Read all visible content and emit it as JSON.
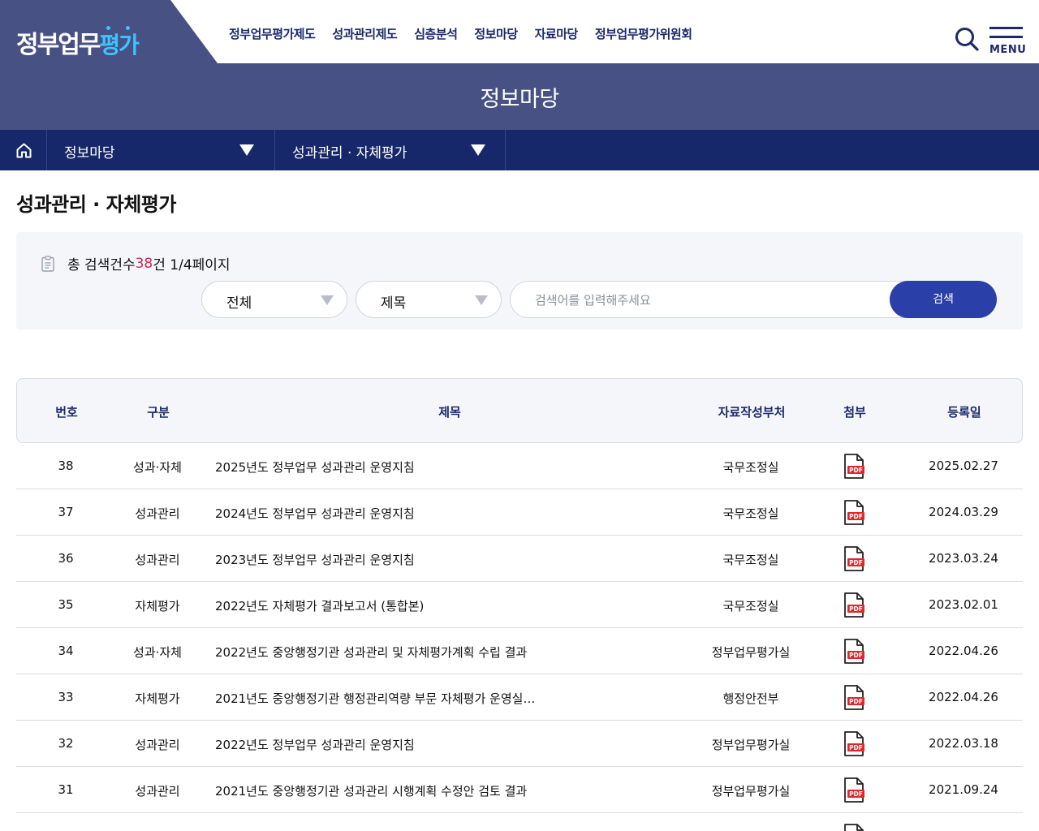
{
  "logo": {
    "text_main": "정부업무",
    "text_accent": "평가"
  },
  "gnb": [
    "정부업무평가제도",
    "성과관리제도",
    "심층분석",
    "정보마당",
    "자료마당",
    "정부업무평가위원회"
  ],
  "header_menu_label": "MENU",
  "visual_title": "정보마당",
  "location": {
    "depth1": "정보마당",
    "depth2": "성과관리 · 자체평가"
  },
  "page_title": "성과관리 · 자체평가",
  "search": {
    "count_prefix": "총 검색건수 ",
    "count_value": "38",
    "count_suffix": "건 1/4페이지",
    "category_select": "전체",
    "field_select": "제목",
    "placeholder": "검색어를 입력해주세요",
    "button_label": "검색"
  },
  "table": {
    "headers": [
      "번호",
      "구분",
      "제목",
      "자료작성부처",
      "첨부",
      "등록일"
    ],
    "rows": [
      {
        "num": "38",
        "category": "성과·자체",
        "title": "2025년도 정부업무 성과관리 운영지침",
        "dept": "국무조정실",
        "attachment": "PDF",
        "date": "2025.02.27"
      },
      {
        "num": "37",
        "category": "성과관리",
        "title": "2024년도 정부업무 성과관리 운영지침",
        "dept": "국무조정실",
        "attachment": "PDF",
        "date": "2024.03.29"
      },
      {
        "num": "36",
        "category": "성과관리",
        "title": "2023년도 정부업무 성과관리 운영지침",
        "dept": "국무조정실",
        "attachment": "PDF",
        "date": "2023.03.24"
      },
      {
        "num": "35",
        "category": "자체평가",
        "title": "2022년도 자체평가 결과보고서 (통합본)",
        "dept": "국무조정실",
        "attachment": "PDF",
        "date": "2023.02.01"
      },
      {
        "num": "34",
        "category": "성과·자체",
        "title": "2022년도 중앙행정기관 성과관리 및 자체평가계획 수립 결과",
        "dept": "정부업무평가실",
        "attachment": "PDF",
        "date": "2022.04.26"
      },
      {
        "num": "33",
        "category": "자체평가",
        "title": "2021년도 중앙행정기관 행정관리역량 부문 자체평가 운영실…",
        "dept": "행정안전부",
        "attachment": "PDF",
        "date": "2022.04.26"
      },
      {
        "num": "32",
        "category": "성과관리",
        "title": "2022년도 정부업무 성과관리 운영지침",
        "dept": "정부업무평가실",
        "attachment": "PDF",
        "date": "2022.03.18"
      },
      {
        "num": "31",
        "category": "성과관리",
        "title": "2021년도 중앙행정기관 성과관리 시행계획 수정안 검토 결과",
        "dept": "정부업무평가실",
        "attachment": "PDF",
        "date": "2021.09.24"
      },
      {
        "num": "",
        "category": "",
        "title": "",
        "dept": "",
        "attachment": "PDF",
        "date": ""
      }
    ]
  }
}
